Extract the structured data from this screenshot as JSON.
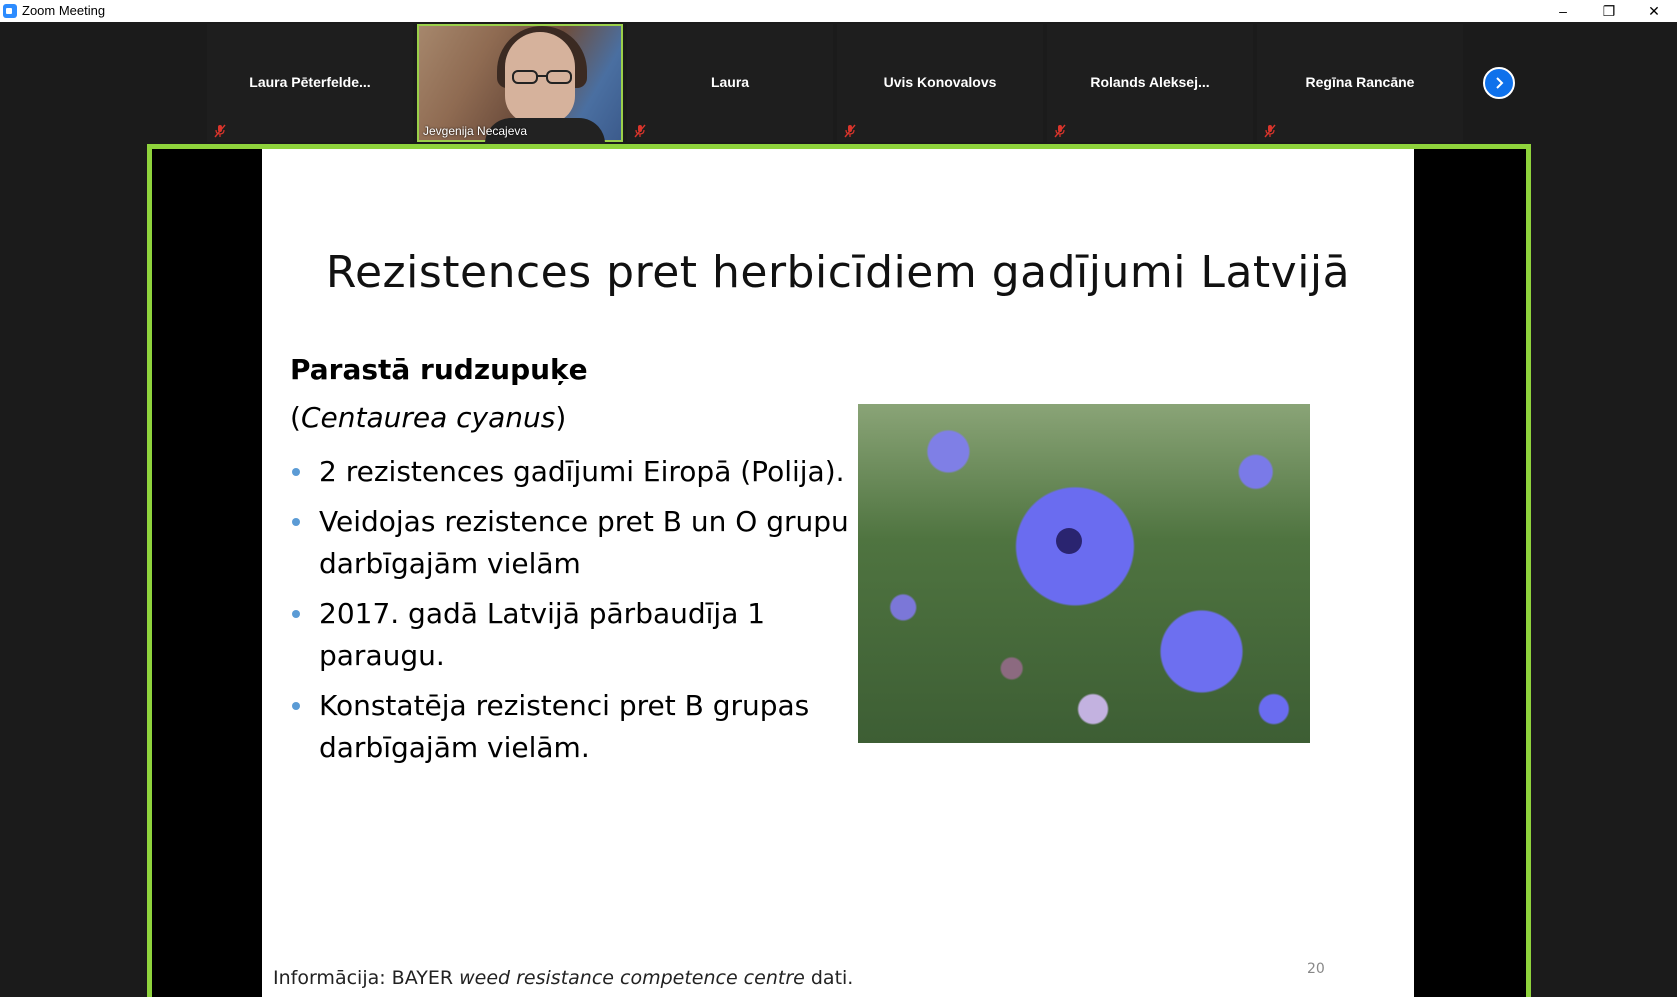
{
  "window": {
    "title": "Zoom Meeting",
    "minimize": "–",
    "restore": "❐",
    "close": "✕"
  },
  "participants": [
    {
      "name": "Laura  Pēterfelde...",
      "muted": true
    },
    {
      "name": "Jevgenija Necajeva",
      "video": true,
      "muted": false
    },
    {
      "name": "Laura",
      "muted": true
    },
    {
      "name": "Uvis Konovalovs",
      "muted": true
    },
    {
      "name": "Rolands  Aleksej...",
      "muted": true
    },
    {
      "name": "Regīna Rancāne",
      "muted": true
    }
  ],
  "icons": {
    "next": "chevron-right-icon",
    "mic": "mic-muted-icon"
  },
  "colors": {
    "share_border": "#8fd33c",
    "accent": "#0e71eb",
    "mute": "#d9342b",
    "bullet": "#5b9bd5"
  },
  "slide": {
    "title": "Rezistences pret herbicīdiem gadījumi Latvijā",
    "subtitle": "Parastā rudzupuķe",
    "latin_open": "(",
    "latin_name": "Centaurea cyanus",
    "latin_close": ")",
    "bullets": [
      "2 rezistences gadījumi Eiropā (Polija).",
      "Veidojas rezistence pret B un O grupu darbīgajām vielām",
      "2017. gadā Latvijā pārbaudīja 1 paraugu.",
      "Konstatēja rezistenci pret B grupas darbīgajām vielām."
    ],
    "page_number": "20",
    "footer_prefix": "Informācija: BAYER ",
    "footer_italic": "weed resistance competence centre",
    "footer_suffix": " dati."
  }
}
